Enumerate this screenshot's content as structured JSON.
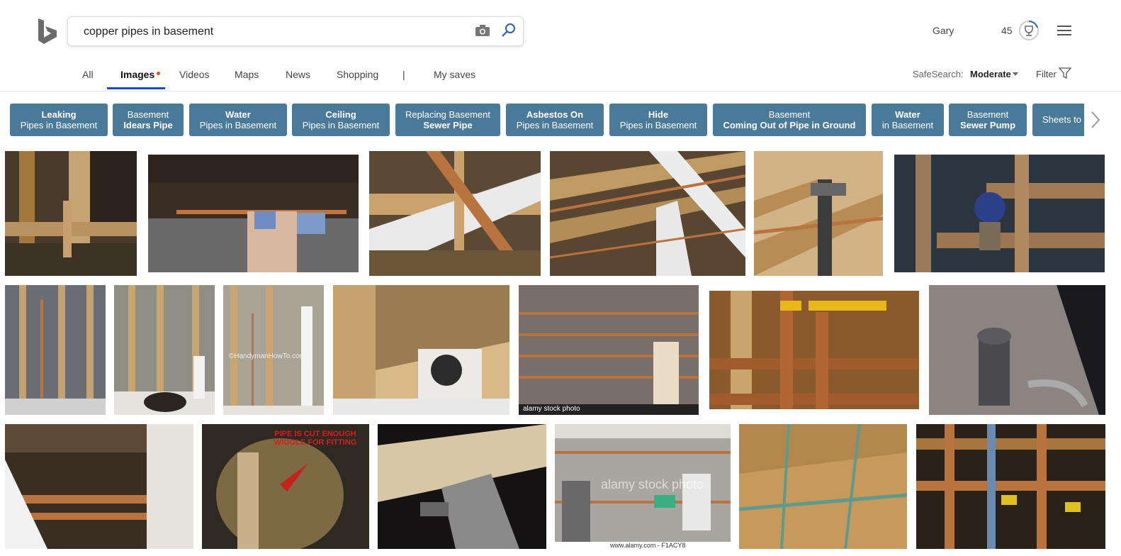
{
  "search": {
    "query": "copper pipes in basement"
  },
  "account": {
    "user": "Gary",
    "points": "45"
  },
  "nav": {
    "tabs": [
      "All",
      "Images",
      "Videos",
      "Maps",
      "News",
      "Shopping",
      "|",
      "My saves"
    ],
    "safesearch_label": "SafeSearch:",
    "safesearch_value": "Moderate",
    "filter_label": "Filter"
  },
  "chips": [
    {
      "l1": "Leaking",
      "l2": "Pipes in Basement",
      "bold": "l1"
    },
    {
      "l1": "Basement",
      "l2": "Idears Pipe",
      "bold": "l2"
    },
    {
      "l1": "Water",
      "l2": "Pipes in Basement",
      "bold": "l1"
    },
    {
      "l1": "Ceiling",
      "l2": "Pipes in Basement",
      "bold": "l1"
    },
    {
      "l1": "Replacing Basement",
      "l2": "Sewer Pipe",
      "bold": "l2"
    },
    {
      "l1": "Asbestos On",
      "l2": "Pipes in Basement",
      "bold": "l1"
    },
    {
      "l1": "Hide",
      "l2": "Pipes in Basement",
      "bold": "l1"
    },
    {
      "l1": "Basement",
      "l2": "Coming Out of Pipe in Ground",
      "bold": "l2"
    },
    {
      "l1": "Water",
      "l2": "in Basement",
      "bold": "l1"
    },
    {
      "l1": "Basement",
      "l2": "Sewer Pump",
      "bold": "l2"
    },
    {
      "l1": "Sheets to",
      "l2": "",
      "bold": "none"
    }
  ],
  "images": {
    "watermark_alamy": "alamy stock photo",
    "watermark_alamy2": "www.alamy.com - F1ACY8",
    "overlay_text": "PIPE IS CUT ENOUGH WIGGLE FOR FITTING",
    "watermark_handyman": "©HandymanHowTo.com",
    "watermark_alamy_center": "alamy stock photo"
  },
  "colors": {
    "chip_bg": "#4a7a99",
    "active_tab": "#174ae4",
    "copper": "#b8733f",
    "wood": "#c9a36b"
  }
}
